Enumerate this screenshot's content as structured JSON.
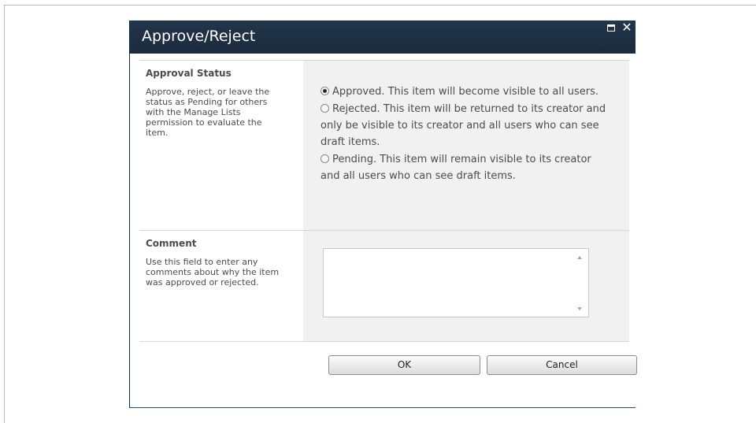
{
  "dialog": {
    "title": "Approve/Reject"
  },
  "approval_status": {
    "label": "Approval Status",
    "description": "Approve, reject, or leave the status as Pending for others with the Manage Lists permission to evaluate the item.",
    "options": [
      {
        "label": "Approved. This item will become visible to all users.",
        "selected": true
      },
      {
        "label": "Rejected. This item will be returned to its creator and only be visible to its creator and all users who can see draft items.",
        "selected": false
      },
      {
        "label": "Pending. This item will remain visible to its creator and all users who can see draft items.",
        "selected": false
      }
    ]
  },
  "comment": {
    "label": "Comment",
    "description": "Use this field to enter any comments about why the item was approved or rejected.",
    "value": ""
  },
  "buttons": {
    "ok": "OK",
    "cancel": "Cancel"
  },
  "colors": {
    "titlebar": "#1f3043",
    "control_background": "#f1f1f1"
  }
}
